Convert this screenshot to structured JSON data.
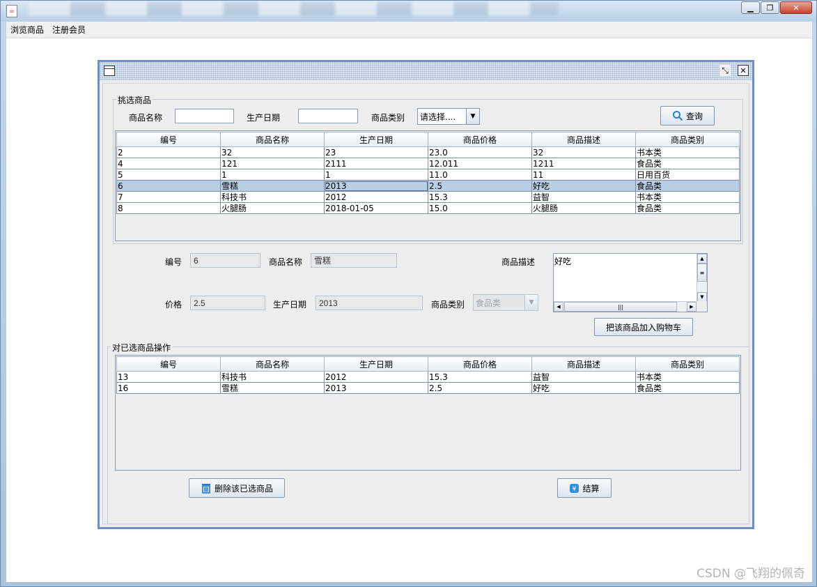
{
  "window": {
    "app_icon": "java-icon"
  },
  "menu": [
    "浏览商品",
    "注册会员"
  ],
  "filter_group": {
    "title": "挑选商品",
    "name_label": "商品名称",
    "name_value": "",
    "date_label": "生产日期",
    "date_value": "",
    "category_label": "商品类别",
    "category_value": "请选择....",
    "query_button": "查询"
  },
  "product_table": {
    "headers": [
      "编号",
      "商品名称",
      "生产日期",
      "商品价格",
      "商品描述",
      "商品类别"
    ],
    "rows": [
      [
        "2",
        "32",
        "23",
        "23.0",
        "32",
        "书本类"
      ],
      [
        "4",
        "121",
        "2111",
        "12.011",
        "1211",
        "食品类"
      ],
      [
        "5",
        "1",
        "1",
        "11.0",
        "11",
        "日用百货"
      ],
      [
        "6",
        "雪糕",
        "2013",
        "2.5",
        "好吃",
        "食品类"
      ],
      [
        "7",
        "科技书",
        "2012",
        "15.3",
        "益智",
        "书本类"
      ],
      [
        "8",
        "火腿肠",
        "2018-01-05",
        "15.0",
        "火腿肠",
        "食品类"
      ]
    ],
    "selected_row": 3
  },
  "detail": {
    "id_label": "编号",
    "id_value": "6",
    "name_label": "商品名称",
    "name_value": "雪糕",
    "desc_label": "商品描述",
    "desc_value": "好吃",
    "price_label": "价格",
    "price_value": "2.5",
    "date_label": "生产日期",
    "date_value": "2013",
    "category_label": "商品类别",
    "category_value": "食品类",
    "add_button": "把该商品加入购物车"
  },
  "cart_group": {
    "title": "对已选商品操作",
    "headers": [
      "编号",
      "商品名称",
      "生产日期",
      "商品价格",
      "商品描述",
      "商品类别"
    ],
    "rows": [
      [
        "13",
        "科技书",
        "2012",
        "15.3",
        "益智",
        "书本类"
      ],
      [
        "16",
        "雪糕",
        "2013",
        "2.5",
        "好吃",
        "食品类"
      ]
    ],
    "delete_button": "删除该已选商品",
    "checkout_button": "结算"
  },
  "watermark": "CSDN @飞翔的佩奇",
  "colors": {
    "selection": "#b8cfe5",
    "frame_border": "#6b8fc6",
    "panel": "#eeeeee"
  }
}
